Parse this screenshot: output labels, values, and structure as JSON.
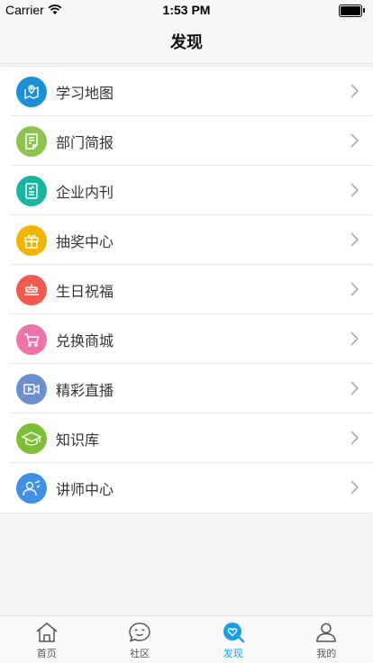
{
  "status_bar": {
    "carrier": "Carrier",
    "time": "1:53 PM",
    "battery_level": 1.0
  },
  "nav": {
    "title": "发现"
  },
  "menu": {
    "items": [
      {
        "label": "学习地图",
        "icon": "map-icon",
        "color": "#1c8fd9"
      },
      {
        "label": "部门简报",
        "icon": "report-icon",
        "color": "#8fc34f"
      },
      {
        "label": "企业内刊",
        "icon": "magazine-icon",
        "color": "#19b59e"
      },
      {
        "label": "抽奖中心",
        "icon": "gift-icon",
        "color": "#f1b500"
      },
      {
        "label": "生日祝福",
        "icon": "cake-icon",
        "color": "#f05a4f"
      },
      {
        "label": "兑换商城",
        "icon": "cart-icon",
        "color": "#ee73a8"
      },
      {
        "label": "精彩直播",
        "icon": "video-icon",
        "color": "#6c8fcf"
      },
      {
        "label": "知识库",
        "icon": "graduation-cap-icon",
        "color": "#7cbf36"
      },
      {
        "label": "讲师中心",
        "icon": "lecturer-icon",
        "color": "#3f8fe2"
      }
    ]
  },
  "tab_bar": {
    "active_color": "#1aa0e2",
    "tabs": [
      {
        "label": "首页",
        "icon": "home-icon",
        "active": false
      },
      {
        "label": "社区",
        "icon": "community-icon",
        "active": false
      },
      {
        "label": "发现",
        "icon": "discover-icon",
        "active": true
      },
      {
        "label": "我的",
        "icon": "profile-icon",
        "active": false
      }
    ]
  }
}
